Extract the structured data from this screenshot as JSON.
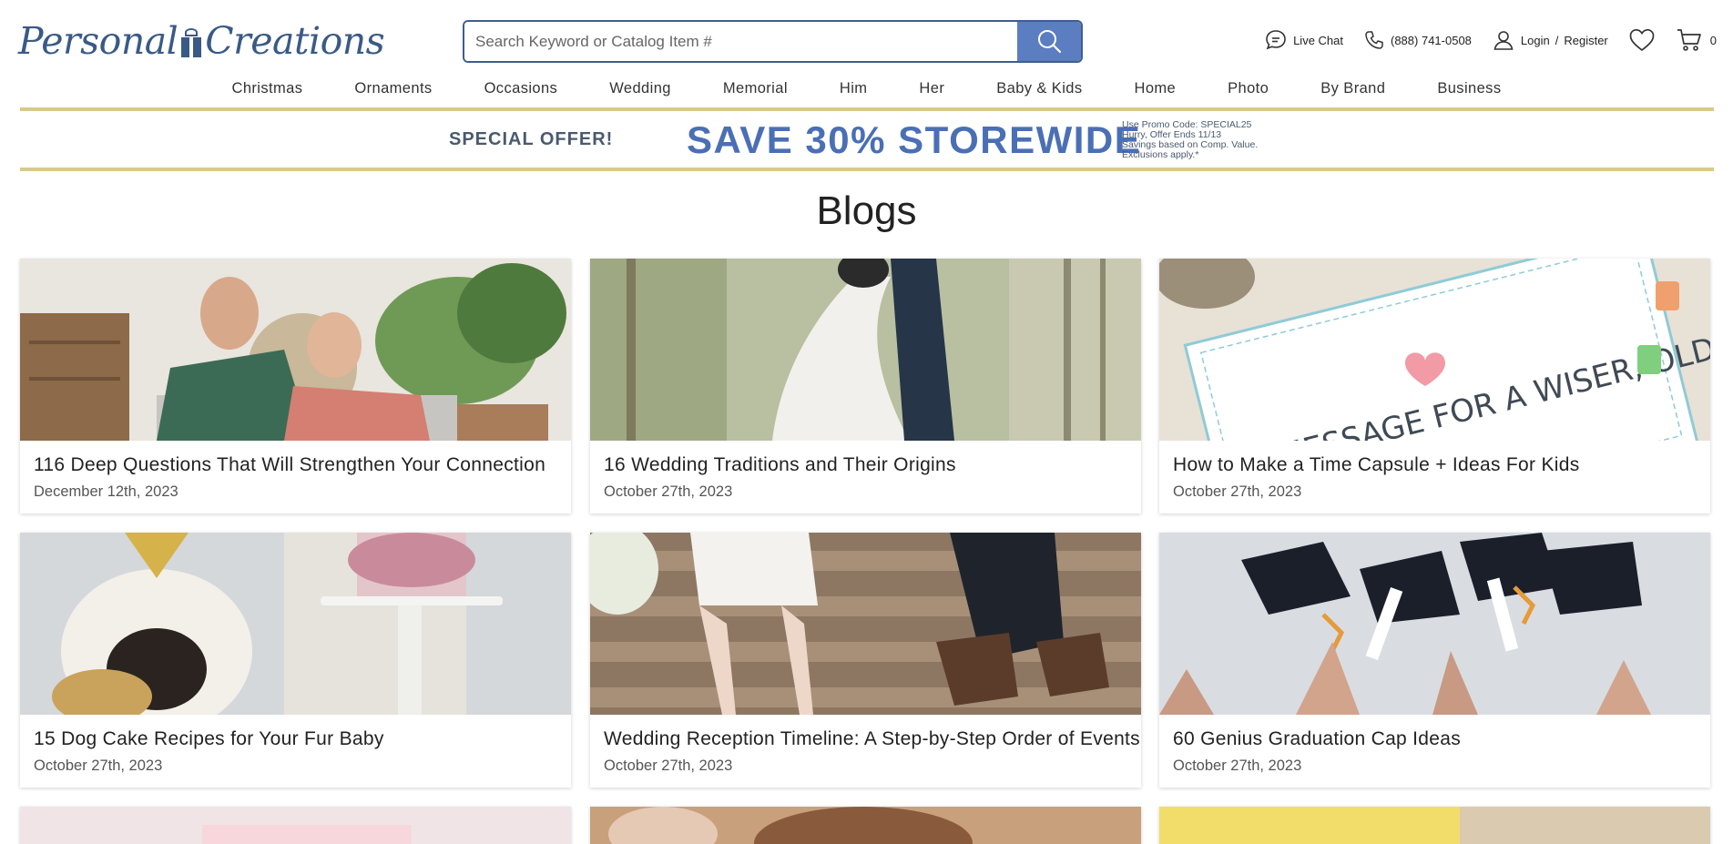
{
  "brand": {
    "logo_before": "Personal",
    "logo_after": "Creations"
  },
  "search": {
    "placeholder": "Search Keyword or Catalog Item #"
  },
  "utils": {
    "live_chat": "Live Chat",
    "phone": "(888) 741-0508",
    "login": "Login",
    "separator": "/",
    "register": "Register",
    "cart_count": "0"
  },
  "nav": [
    "Christmas",
    "Ornaments",
    "Occasions",
    "Wedding",
    "Memorial",
    "Him",
    "Her",
    "Baby & Kids",
    "Home",
    "Photo",
    "By Brand",
    "Business"
  ],
  "promo": {
    "label": "SPECIAL OFFER!",
    "headline": "SAVE 30% STOREWIDE",
    "fine_print": [
      "Use Promo Code: SPECIAL25",
      "Hurry, Offer Ends 11/13",
      "Savings based on Comp. Value.",
      "Exclusions apply.*"
    ]
  },
  "page": {
    "title": "Blogs"
  },
  "cards": [
    {
      "title": "116 Deep Questions That Will Strengthen Your Connection",
      "date": "December 12th, 2023"
    },
    {
      "title": "16 Wedding Traditions and Their Origins",
      "date": "October 27th, 2023"
    },
    {
      "title": "How to Make a Time Capsule + Ideas For Kids",
      "date": "October 27th, 2023"
    },
    {
      "title": "15 Dog Cake Recipes for Your Fur Baby",
      "date": "October 27th, 2023"
    },
    {
      "title": "Wedding Reception Timeline: A Step-by-Step Order of Events",
      "date": "October 27th, 2023"
    },
    {
      "title": "60 Genius Graduation Cap Ideas",
      "date": "October 27th, 2023"
    }
  ],
  "colors": {
    "brand_blue": "#3a5a86",
    "accent_blue": "#4b6fb5",
    "search_button": "#5b7ec0",
    "promo_border": "#d8c98c"
  }
}
